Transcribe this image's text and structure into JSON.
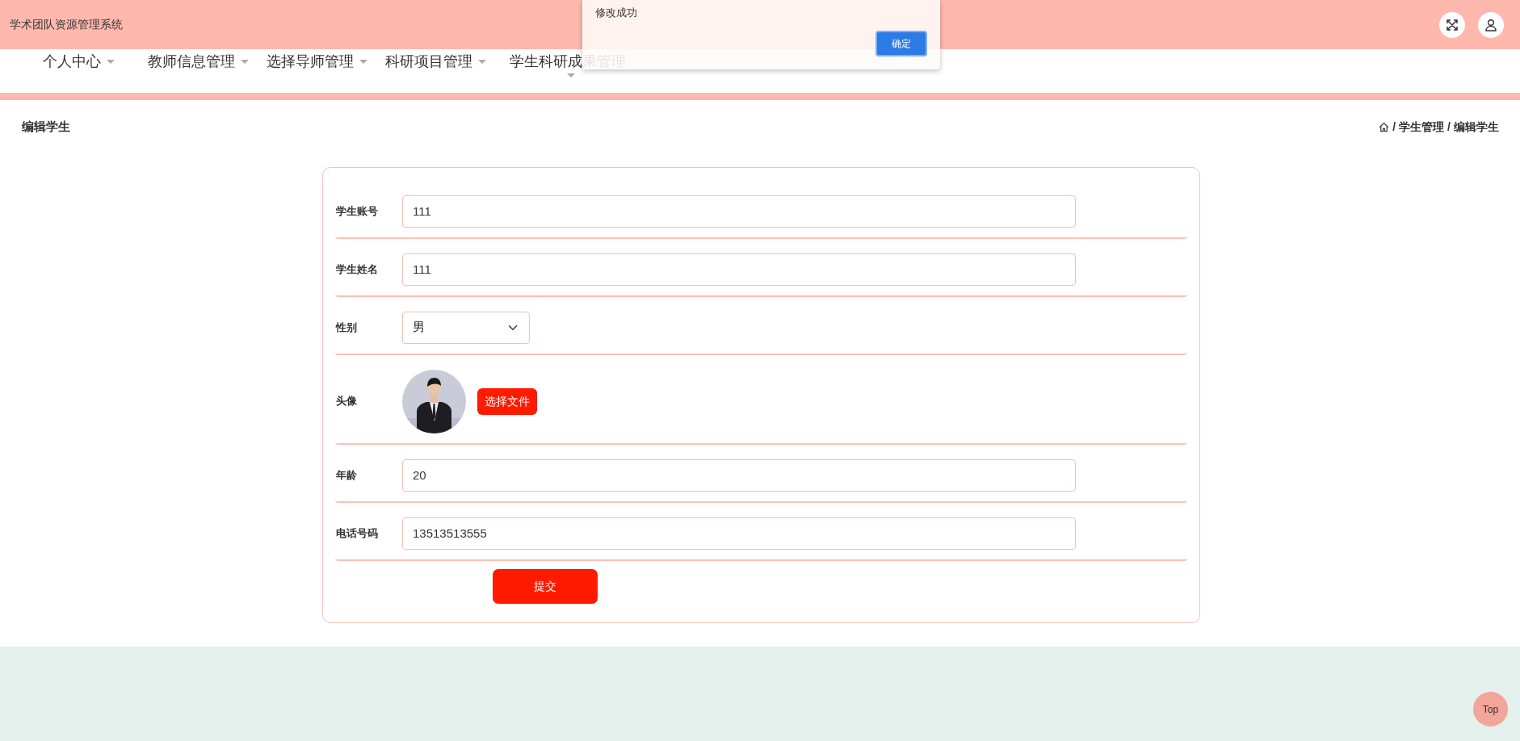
{
  "app_title": "学术团队资源管理系统",
  "nav": [
    {
      "label": "个人中心"
    },
    {
      "label": "教师信息管理"
    },
    {
      "label": "选择导师管理"
    },
    {
      "label": "科研项目管理"
    },
    {
      "label": "学生科研成果管理"
    }
  ],
  "dialog": {
    "message": "修改成功",
    "button": "确定"
  },
  "page_title": "编辑学生",
  "breadcrumb": {
    "separator": "/",
    "items": [
      "学生管理",
      "编辑学生"
    ]
  },
  "form": {
    "fields": [
      {
        "kind": "text",
        "label": "学生账号",
        "value": "111"
      },
      {
        "kind": "text",
        "label": "学生姓名",
        "value": "111"
      },
      {
        "kind": "select",
        "label": "性别",
        "value": "男"
      },
      {
        "label": "头像",
        "button": "选择文件"
      },
      {
        "kind": "text",
        "label": "年龄",
        "value": "20"
      },
      {
        "kind": "text",
        "label": "电话号码",
        "value": "13513513555"
      }
    ],
    "submit": "提交"
  },
  "back_to_top": "Top"
}
